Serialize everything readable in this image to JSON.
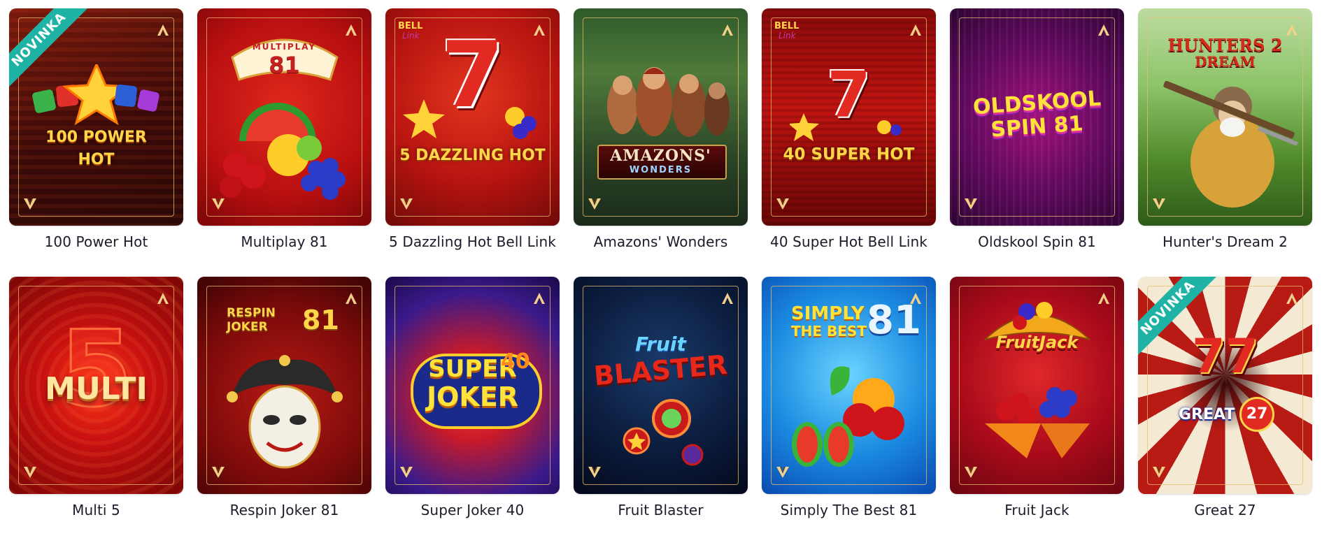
{
  "badge_label": "NOVINKA",
  "games": [
    {
      "title": "100 Power Hot",
      "new": true
    },
    {
      "title": "Multiplay 81",
      "new": false
    },
    {
      "title": "5 Dazzling Hot Bell Link",
      "new": false
    },
    {
      "title": "Amazons' Wonders",
      "new": false
    },
    {
      "title": "40 Super Hot Bell Link",
      "new": false
    },
    {
      "title": "Oldskool Spin 81",
      "new": false
    },
    {
      "title": "Hunter's Dream 2",
      "new": false
    },
    {
      "title": "Multi 5",
      "new": false
    },
    {
      "title": "Respin Joker 81",
      "new": false
    },
    {
      "title": "Super Joker 40",
      "new": false
    },
    {
      "title": "Fruit Blaster",
      "new": false
    },
    {
      "title": "Simply The Best 81",
      "new": false
    },
    {
      "title": "Fruit Jack",
      "new": false
    },
    {
      "title": "Great 27",
      "new": true
    }
  ],
  "art_text": {
    "power_hot_line1": "100 POWER",
    "power_hot_line2": "HOT",
    "multiplay_top": "MULTIPLAY",
    "multiplay_num": "81",
    "dazzling_bell": "BELL",
    "dazzling_link": "Link",
    "dazzling_seven": "7",
    "dazzling_name": "5 DAZZLING HOT",
    "amazons_line1": "AMAZONS'",
    "amazons_line2": "WONDERS",
    "superhot_bell": "BELL",
    "superhot_link": "Link",
    "superhot_seven": "7",
    "superhot_name": "40 SUPER HOT",
    "oldskool_line1": "OLDSKOOL",
    "oldskool_line2": "SPIN 81",
    "hunters_line1": "HUNTERS 2",
    "hunters_line2": "DREAM",
    "multi5_num": "5",
    "multi5_word": "MULTI",
    "respin_line1": "RESPIN",
    "respin_line2": "JOKER",
    "respin_num": "81",
    "superjoker_line1": "SUPER",
    "superjoker_num": "40",
    "superjoker_line2": "JOKER",
    "fruitblaster_line1": "Fruit",
    "fruitblaster_line2": "BLASTER",
    "simply_line1": "SIMPLY",
    "simply_line2": "THE BEST",
    "simply_num": "81",
    "fruitjack_word": "FruitJack",
    "great_sevens": "77",
    "great_word": "GREAT",
    "great_num": "27"
  },
  "colors": {
    "badge": "#1fb3a5",
    "frame_gold": "#e8be6e",
    "title_text": "#1b1b2a"
  }
}
